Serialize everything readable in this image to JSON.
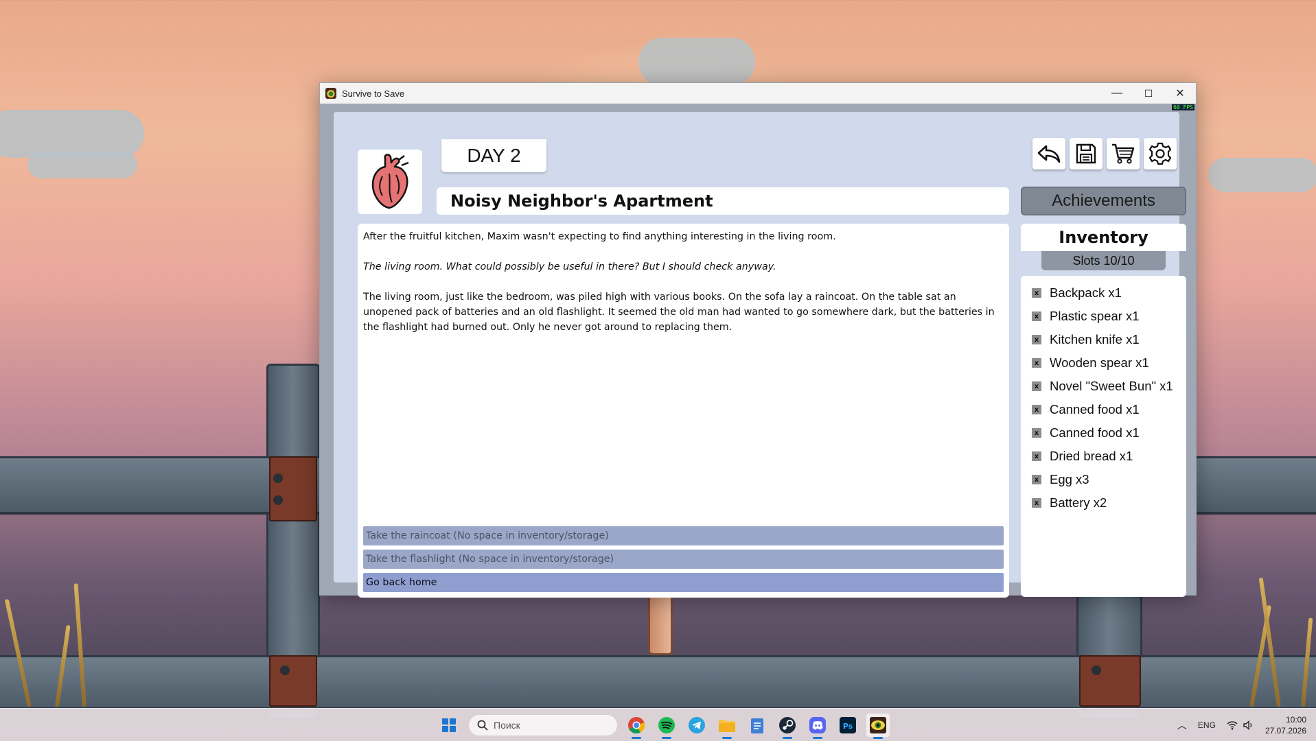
{
  "window": {
    "title": "Survive to Save",
    "fps": "60 FPS",
    "controls": {
      "minimize": "—",
      "maximize": "☐",
      "close": "✕"
    }
  },
  "game": {
    "day": "DAY 2",
    "location": "Noisy Neighbor's Apartment",
    "toolbar": [
      {
        "name": "back",
        "icon": "back-arrow-icon"
      },
      {
        "name": "save",
        "icon": "floppy-disk-icon"
      },
      {
        "name": "shop",
        "icon": "cart-icon"
      },
      {
        "name": "settings",
        "icon": "gear-icon"
      }
    ],
    "achievements_label": "Achievements",
    "story": {
      "paragraphs": [
        "After the fruitful kitchen, Maxim wasn't expecting to find anything interesting in the living room.",
        "The living room. What could possibly be useful in there? But I should check anyway.",
        "The living room, just like the bedroom, was piled high with various books. On the sofa lay a raincoat. On the table sat an unopened pack of batteries and an old flashlight. It seemed the old man had wanted to go somewhere dark, but the batteries in the flashlight had burned out. Only he never got around to replacing them."
      ]
    },
    "choices": [
      {
        "label": "Take the raincoat (No space in inventory/storage)",
        "enabled": false
      },
      {
        "label": "Take the flashlight (No space in inventory/storage)",
        "enabled": false
      },
      {
        "label": "Go back home",
        "enabled": true
      }
    ],
    "inventory": {
      "title": "Inventory",
      "slots": "Slots 10/10",
      "drop_label": "x",
      "items": [
        "Backpack x1",
        "Plastic spear x1",
        "Kitchen knife x1",
        "Wooden spear x1",
        "Novel \"Sweet Bun\" x1",
        "Canned food x1",
        "Canned food x1",
        "Dried bread x1",
        "Egg x3",
        "Battery x2"
      ]
    }
  },
  "taskbar": {
    "search_placeholder": "Поиск",
    "apps": [
      "chrome-icon",
      "spotify-icon",
      "telegram-icon",
      "file-explorer-icon",
      "notepad-icon",
      "steam-icon",
      "discord-icon",
      "photoshop-icon",
      "survive-to-save-icon"
    ],
    "tray": {
      "language": "ENG",
      "time": "10:00",
      "date": "27.07.2026"
    }
  },
  "colors": {
    "board": "#d1d9ec",
    "choice_disabled": "#9aa7c8",
    "choice_enabled": "#8e9fcf",
    "achievements": "#7f8893",
    "slots": "#8d96a2"
  }
}
